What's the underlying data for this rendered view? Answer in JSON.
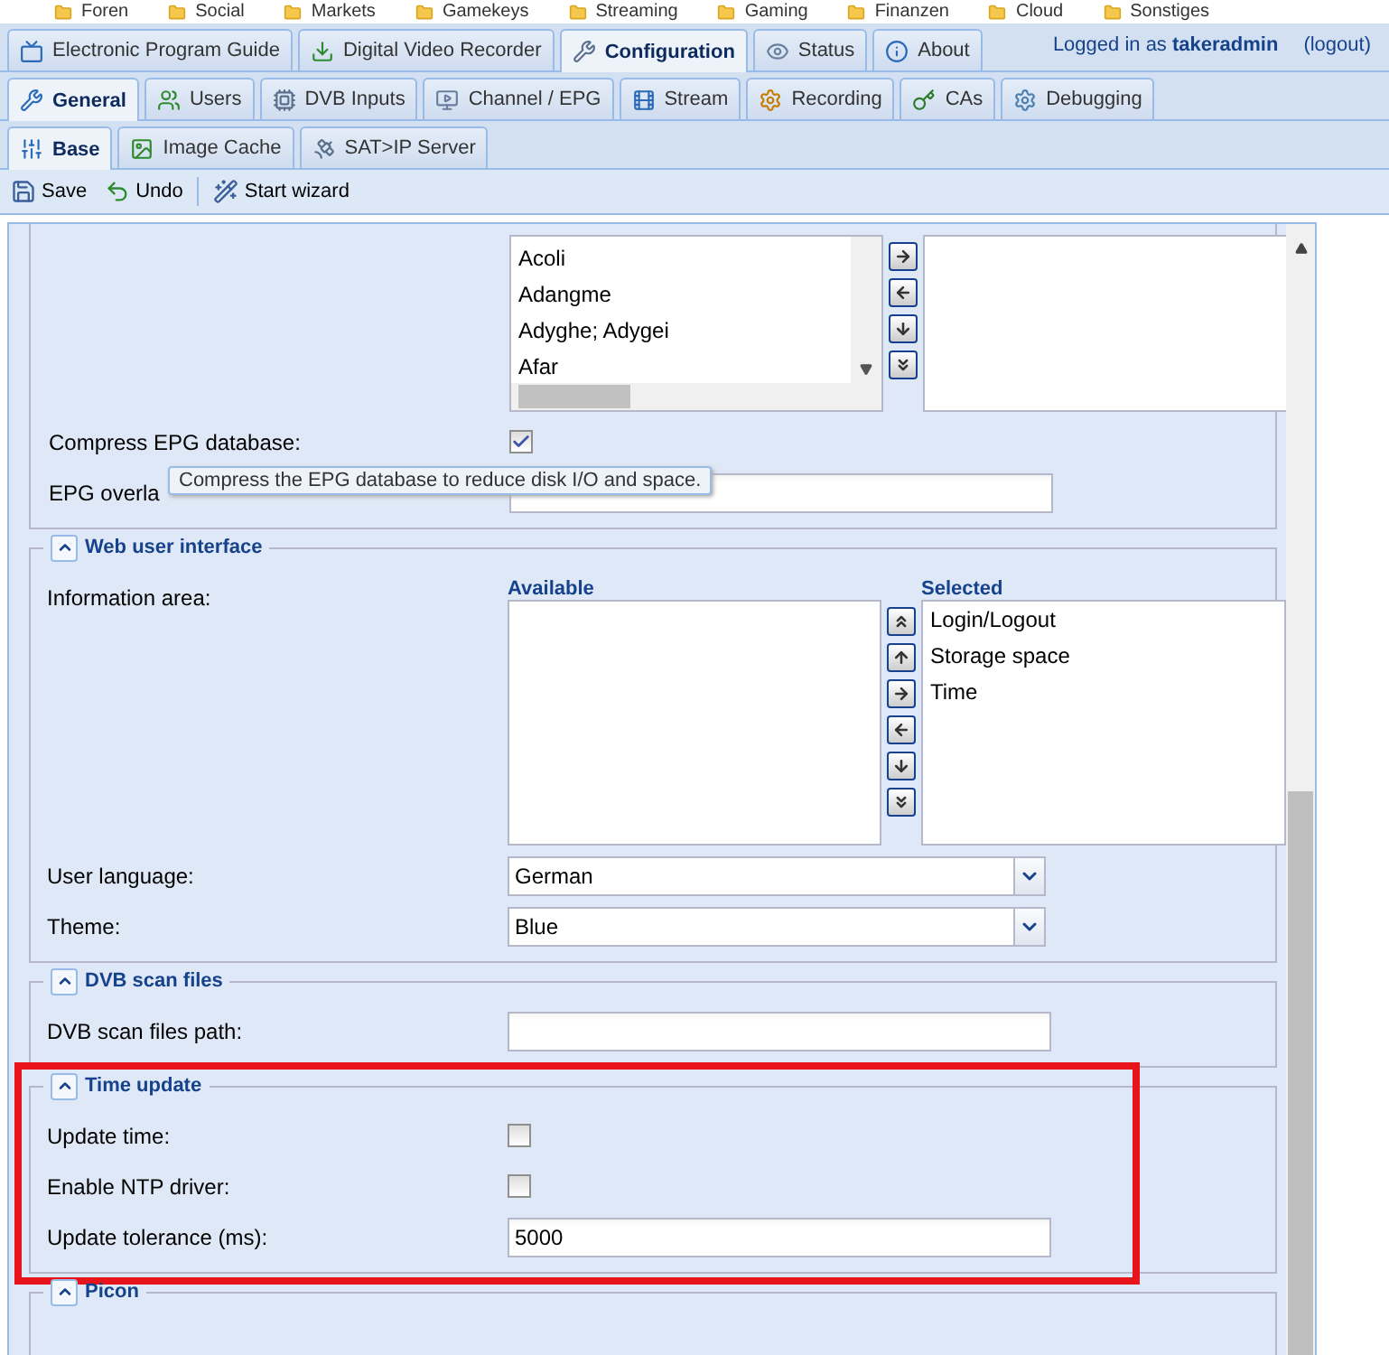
{
  "bookmarks": [
    "Foren",
    "Social",
    "Markets",
    "Gamekeys",
    "Streaming",
    "Gaming",
    "Finanzen",
    "Cloud",
    "Sonstiges"
  ],
  "main_tabs": [
    {
      "label": "Electronic Program Guide",
      "selected": false
    },
    {
      "label": "Digital Video Recorder",
      "selected": false
    },
    {
      "label": "Configuration",
      "selected": true
    },
    {
      "label": "Status",
      "selected": false
    },
    {
      "label": "About",
      "selected": false
    }
  ],
  "login": {
    "prefix": "Logged in as",
    "user": "takeradmin",
    "logout": "(logout)"
  },
  "sub_tabs": [
    {
      "label": "General",
      "selected": true
    },
    {
      "label": "Users",
      "selected": false
    },
    {
      "label": "DVB Inputs",
      "selected": false
    },
    {
      "label": "Channel / EPG",
      "selected": false
    },
    {
      "label": "Stream",
      "selected": false
    },
    {
      "label": "Recording",
      "selected": false
    },
    {
      "label": "CAs",
      "selected": false
    },
    {
      "label": "Debugging",
      "selected": false
    }
  ],
  "section_tabs": [
    {
      "label": "Base",
      "selected": true
    },
    {
      "label": "Image Cache",
      "selected": false
    },
    {
      "label": "SAT>IP Server",
      "selected": false
    }
  ],
  "toolbar": [
    {
      "label": "Save",
      "kind": "save"
    },
    {
      "label": "Undo",
      "kind": "undo"
    },
    {
      "label": "Start wizard",
      "kind": "wizard"
    }
  ],
  "sections": [
    {
      "fields": [
        {
          "kind": "languages",
          "available": [
            "Acoli",
            "Adangme",
            "Adyghe; Adygei",
            "Afar"
          ]
        },
        {
          "kind": "checkbox",
          "label": "Compress EPG database:",
          "checked": true,
          "tooltip": "Compress the EPG database to reduce disk I/O and space."
        },
        {
          "kind": "text",
          "label": "EPG overla"
        }
      ]
    },
    {
      "title": "Web user interface",
      "expanded": true,
      "fields": [
        {
          "kind": "infoarea",
          "label": "Information area:",
          "available_title": "Available",
          "selected_title": "Selected",
          "selected": [
            "Login/Logout",
            "Storage space",
            "Time"
          ]
        },
        {
          "kind": "select",
          "label": "User language:",
          "value": "German"
        },
        {
          "kind": "select",
          "label": "Theme:",
          "value": "Blue"
        }
      ]
    },
    {
      "title": "DVB scan files",
      "expanded": true,
      "fields": [
        {
          "kind": "text",
          "label": "DVB scan files path:"
        }
      ]
    },
    {
      "title": "Time update",
      "expanded": true,
      "highlighted": true,
      "fields": [
        {
          "kind": "checkbox",
          "label": "Update time:",
          "checked": false
        },
        {
          "kind": "checkbox",
          "label": "Enable NTP driver:",
          "checked": false
        },
        {
          "kind": "text",
          "label": "Update tolerance (ms):",
          "value": "5000"
        }
      ]
    },
    {
      "title": "Picon",
      "expanded": true
    }
  ]
}
